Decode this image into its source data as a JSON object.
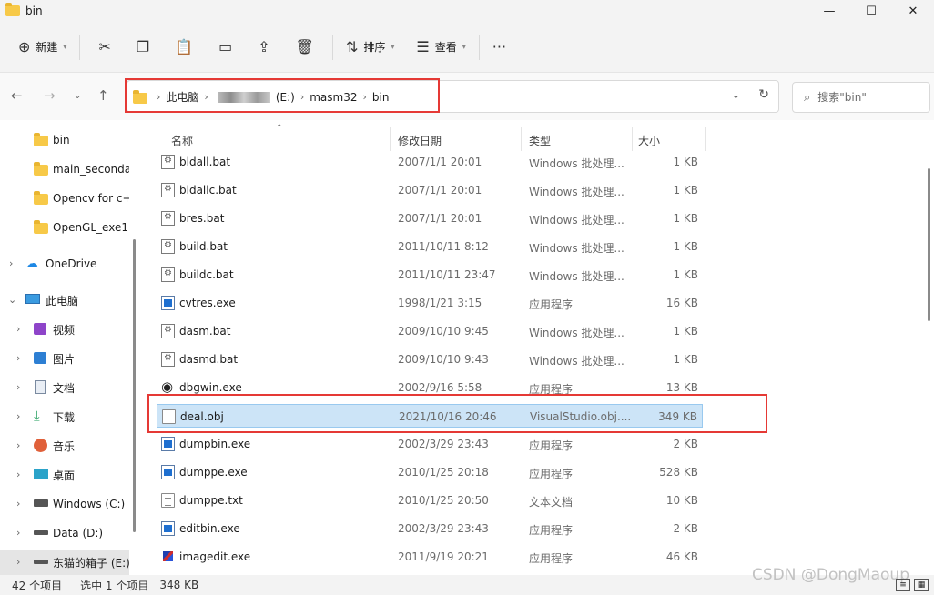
{
  "window": {
    "title": "bin",
    "controls": {
      "minimize": "—",
      "maximize": "☐",
      "close": "✕"
    }
  },
  "toolbar": {
    "new_label": "新建",
    "sort_label": "排序",
    "view_label": "查看",
    "more": "···"
  },
  "address": {
    "crumbs": [
      "此电脑",
      "(E:)",
      "masm32",
      "bin"
    ]
  },
  "search": {
    "placeholder": "搜索\"bin\""
  },
  "sidebar": {
    "items": [
      {
        "label": "bin"
      },
      {
        "label": "main_seconda"
      },
      {
        "label": "Opencv for c+"
      },
      {
        "label": "OpenGL_exe1"
      },
      {
        "label": "OneDrive"
      },
      {
        "label": "此电脑"
      },
      {
        "label": "视频"
      },
      {
        "label": "图片"
      },
      {
        "label": "文档"
      },
      {
        "label": "下载"
      },
      {
        "label": "音乐"
      },
      {
        "label": "桌面"
      },
      {
        "label": "Windows (C:)"
      },
      {
        "label": "Data (D:)"
      },
      {
        "label": "东猫的箱子 (E:)"
      }
    ]
  },
  "columns": {
    "name": "名称",
    "date": "修改日期",
    "type": "类型",
    "size": "大小"
  },
  "files": [
    {
      "name": "bldall.bat",
      "date": "2007/1/1 20:01",
      "type": "Windows 批处理...",
      "size": "1 KB",
      "icon": "bat"
    },
    {
      "name": "bldallc.bat",
      "date": "2007/1/1 20:01",
      "type": "Windows 批处理...",
      "size": "1 KB",
      "icon": "bat"
    },
    {
      "name": "bres.bat",
      "date": "2007/1/1 20:01",
      "type": "Windows 批处理...",
      "size": "1 KB",
      "icon": "bat"
    },
    {
      "name": "build.bat",
      "date": "2011/10/11 8:12",
      "type": "Windows 批处理...",
      "size": "1 KB",
      "icon": "bat"
    },
    {
      "name": "buildc.bat",
      "date": "2011/10/11 23:47",
      "type": "Windows 批处理...",
      "size": "1 KB",
      "icon": "bat"
    },
    {
      "name": "cvtres.exe",
      "date": "1998/1/21 3:15",
      "type": "应用程序",
      "size": "16 KB",
      "icon": "exe"
    },
    {
      "name": "dasm.bat",
      "date": "2009/10/10 9:45",
      "type": "Windows 批处理...",
      "size": "1 KB",
      "icon": "bat"
    },
    {
      "name": "dasmd.bat",
      "date": "2009/10/10 9:43",
      "type": "Windows 批处理...",
      "size": "1 KB",
      "icon": "bat"
    },
    {
      "name": "dbgwin.exe",
      "date": "2002/9/16 5:58",
      "type": "应用程序",
      "size": "13 KB",
      "icon": "eye"
    },
    {
      "name": "deal.obj",
      "date": "2021/10/16 20:46",
      "type": "VisualStudio.obj....",
      "size": "349 KB",
      "icon": "obj",
      "selected": true
    },
    {
      "name": "dumpbin.exe",
      "date": "2002/3/29 23:43",
      "type": "应用程序",
      "size": "2 KB",
      "icon": "exe"
    },
    {
      "name": "dumppe.exe",
      "date": "2010/1/25 20:18",
      "type": "应用程序",
      "size": "528 KB",
      "icon": "exe"
    },
    {
      "name": "dumppe.txt",
      "date": "2010/1/25 20:50",
      "type": "文本文档",
      "size": "10 KB",
      "icon": "txt"
    },
    {
      "name": "editbin.exe",
      "date": "2002/3/29 23:43",
      "type": "应用程序",
      "size": "2 KB",
      "icon": "exe"
    },
    {
      "name": "imagedit.exe",
      "date": "2011/9/19 20:21",
      "type": "应用程序",
      "size": "46 KB",
      "icon": "img"
    }
  ],
  "status": {
    "count": "42 个项目",
    "selected": "选中 1 个项目",
    "size": "348 KB"
  },
  "watermark": "CSDN @DongMaoup",
  "colors": {
    "selection": "#cce4f7",
    "highlight_box": "#e53935",
    "folder": "#f7c948"
  }
}
